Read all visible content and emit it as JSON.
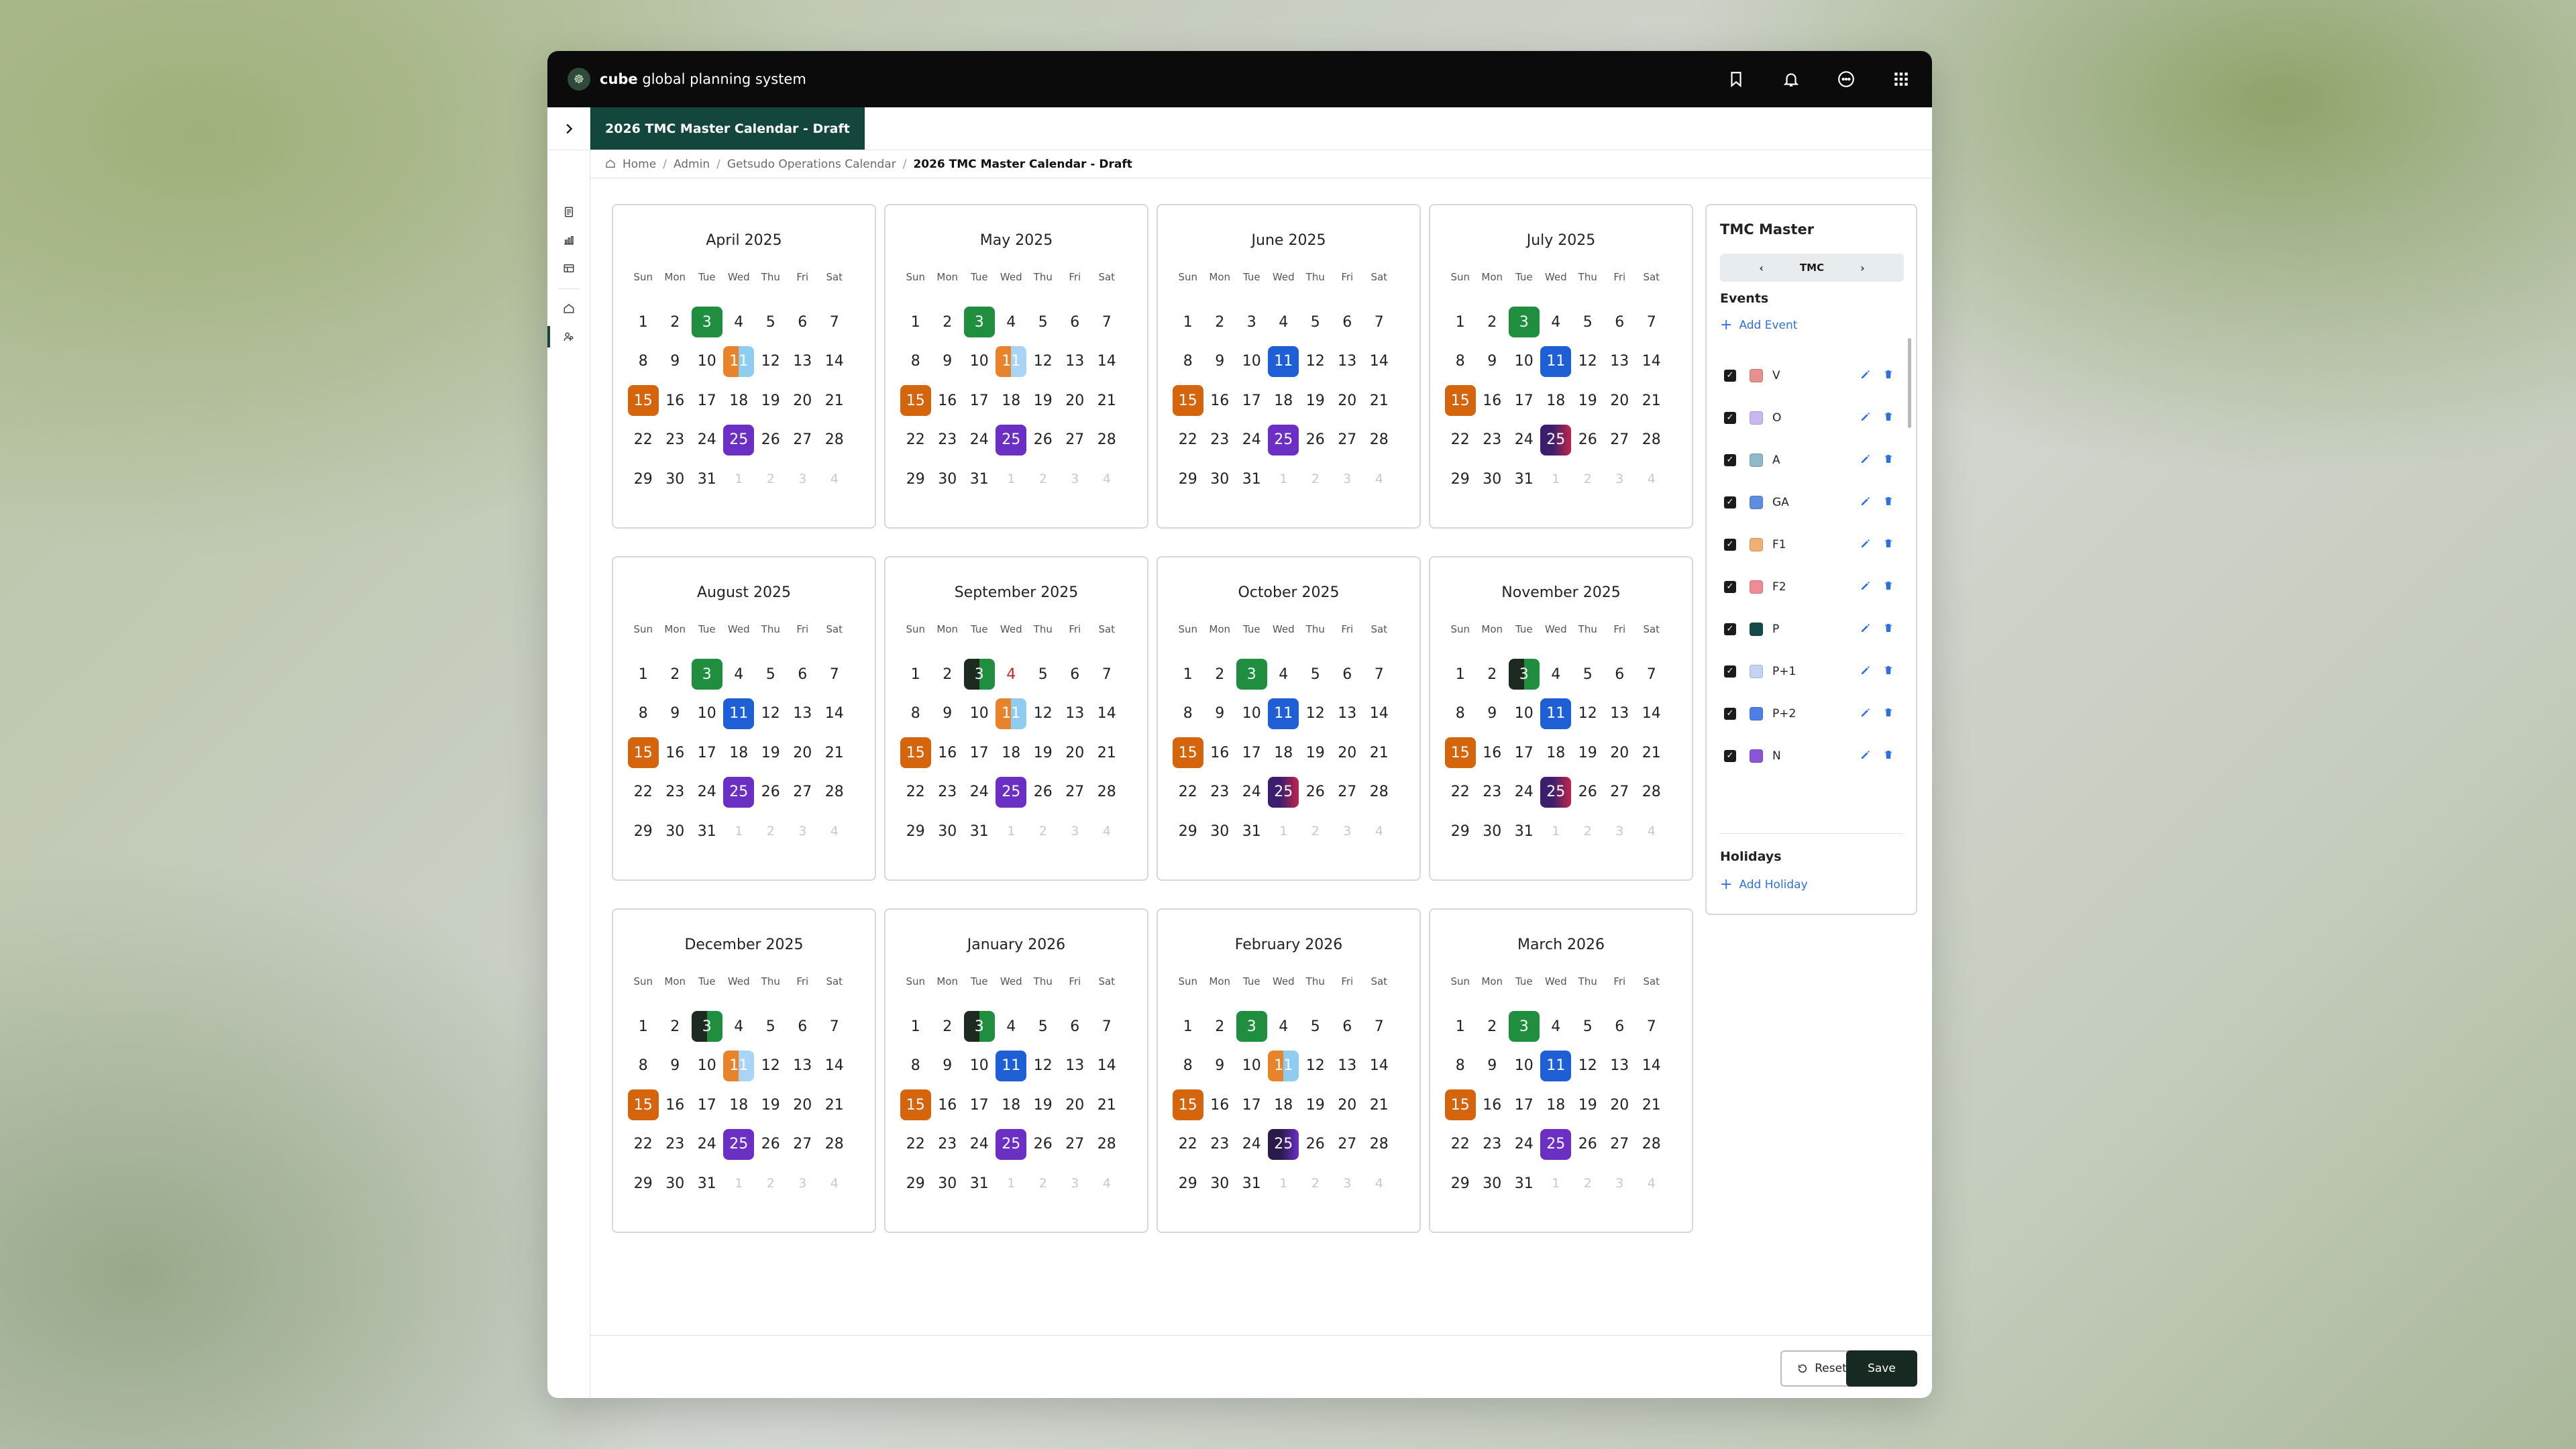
{
  "app": {
    "brand_bold": "cube",
    "brand_rest": " global planning system"
  },
  "tab": {
    "label": "2026 TMC Master Calendar - Draft"
  },
  "breadcrumb": {
    "items": [
      "Home",
      "Admin",
      "Getsudo Operations Calendar"
    ],
    "current": "2026 TMC Master Calendar - Draft"
  },
  "dow": [
    "Sun",
    "Mon",
    "Tue",
    "Wed",
    "Thu",
    "Fri",
    "Sat"
  ],
  "months": [
    {
      "title": "April 2025",
      "marks": {
        "3": "green",
        "11": "split-ob",
        "15": "orange",
        "25": "purple"
      }
    },
    {
      "title": "May 2025",
      "marks": {
        "3": "green",
        "11": "split-ol",
        "15": "orange",
        "25": "purple"
      }
    },
    {
      "title": "June 2025",
      "marks": {
        "11": "blue",
        "15": "orange",
        "25": "purple"
      }
    },
    {
      "title": "July 2025",
      "marks": {
        "3": "green",
        "11": "blue",
        "15": "orange",
        "25": "split-np"
      }
    },
    {
      "title": "August 2025",
      "marks": {
        "3": "green",
        "11": "blue",
        "15": "orange",
        "25": "purple"
      }
    },
    {
      "title": "September 2025",
      "marks": {
        "3": "split-dg",
        "4": "red",
        "11": "split-ob",
        "15": "orange",
        "25": "purple"
      }
    },
    {
      "title": "October 2025",
      "marks": {
        "3": "green",
        "11": "blue",
        "15": "orange",
        "25": "split-np"
      }
    },
    {
      "title": "November 2025",
      "marks": {
        "3": "split-dg",
        "11": "blue",
        "15": "orange",
        "25": "split-np"
      }
    },
    {
      "title": "December 2025",
      "marks": {
        "3": "split-dg",
        "11": "split-ol",
        "15": "orange",
        "25": "purple"
      }
    },
    {
      "title": "January 2026",
      "marks": {
        "3": "split-dg",
        "11": "blue",
        "15": "orange",
        "25": "purple"
      }
    },
    {
      "title": "February 2026",
      "marks": {
        "3": "green",
        "11": "split-ob",
        "15": "orange",
        "25": "split-ndp"
      }
    },
    {
      "title": "March 2026",
      "marks": {
        "3": "green",
        "11": "blue",
        "15": "orange",
        "25": "purple"
      }
    }
  ],
  "panel": {
    "title": "TMC Master",
    "selector_value": "TMC",
    "events_heading": "Events",
    "add_event": "Add Event",
    "events": [
      {
        "label": "V",
        "color": "#e88f8f",
        "checked": true
      },
      {
        "label": "O",
        "color": "#c9b8ef",
        "checked": true
      },
      {
        "label": "A",
        "color": "#8fb8c9",
        "checked": true
      },
      {
        "label": "GA",
        "color": "#5d8de0",
        "checked": true
      },
      {
        "label": "F1",
        "color": "#f0b070",
        "checked": true
      },
      {
        "label": "F2",
        "color": "#f08a95",
        "checked": true
      },
      {
        "label": "P",
        "color": "#144a48",
        "checked": true
      },
      {
        "label": "P+1",
        "color": "#c4d3f3",
        "checked": true
      },
      {
        "label": "P+2",
        "color": "#4d7fe6",
        "checked": true
      },
      {
        "label": "N",
        "color": "#8a55d6",
        "checked": true
      }
    ],
    "holidays_heading": "Holidays",
    "add_holiday": "Add Holiday"
  },
  "footer": {
    "reset_label": "Reset",
    "save_label": "Save"
  },
  "colors": {
    "accent": "#13463d",
    "link": "#2f6fe0",
    "save_bg": "#162a22"
  }
}
